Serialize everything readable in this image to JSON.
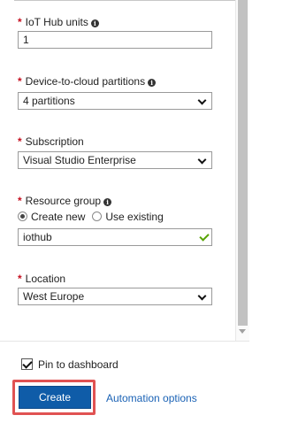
{
  "form": {
    "iot_hub_units": {
      "required_mark": "*",
      "label": "IoT Hub units",
      "info_glyph": "i",
      "value": "1"
    },
    "d2c_partitions": {
      "required_mark": "*",
      "label": "Device-to-cloud partitions",
      "info_glyph": "i",
      "value": "4 partitions"
    },
    "subscription": {
      "required_mark": "*",
      "label": "Subscription",
      "value": "Visual Studio Enterprise"
    },
    "resource_group": {
      "required_mark": "*",
      "label": "Resource group",
      "info_glyph": "i",
      "options": [
        {
          "label": "Create new",
          "selected": true
        },
        {
          "label": "Use existing",
          "selected": false
        }
      ],
      "value": "iothub",
      "valid": true
    },
    "location": {
      "required_mark": "*",
      "label": "Location",
      "value": "West Europe"
    }
  },
  "footer": {
    "pin_to_dashboard": {
      "label": "Pin to dashboard",
      "checked": true
    },
    "create_button": "Create",
    "automation_link": "Automation options"
  },
  "colors": {
    "required": "#c50f1f",
    "primary_button": "#0f5ca8",
    "link": "#1a62b5",
    "valid_check": "#57a300",
    "highlight_frame": "#e05252"
  },
  "icons": {
    "info": "info-circle-icon",
    "dropdown": "chevron-down-icon",
    "valid": "checkmark-icon"
  }
}
